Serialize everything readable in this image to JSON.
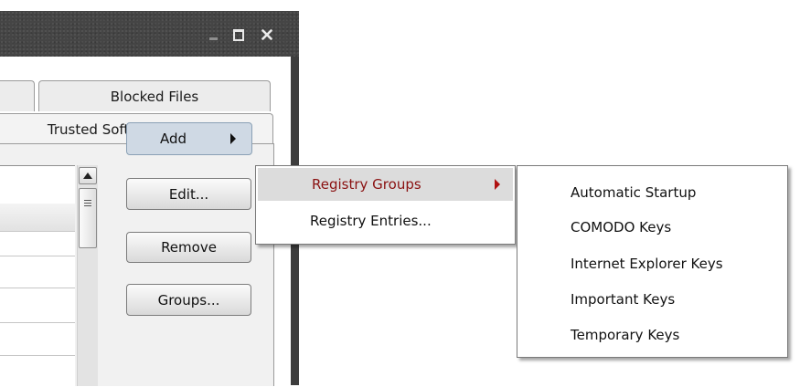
{
  "window": {
    "controls": {
      "minimize_icon": "minimize-icon",
      "maximize_icon": "maximize-icon",
      "close_icon": "close-icon"
    }
  },
  "tabs": {
    "blocked_files": "Blocked Files",
    "trusted_vendors": "Trusted Software Vendors"
  },
  "buttons": {
    "add": "Add",
    "edit": "Edit...",
    "remove": "Remove",
    "groups": "Groups..."
  },
  "add_menu": {
    "items": [
      {
        "label": "Registry Groups",
        "has_submenu": true,
        "highlighted": true
      },
      {
        "label": "Registry Entries..."
      }
    ]
  },
  "registry_groups_menu": {
    "items": [
      {
        "label": "Automatic Startup"
      },
      {
        "label": "COMODO Keys"
      },
      {
        "label": "Internet Explorer Keys"
      },
      {
        "label": "Important Keys"
      },
      {
        "label": "Temporary Keys"
      }
    ]
  },
  "colors": {
    "highlight_text": "#8a1111",
    "titlebar": "#454545"
  }
}
